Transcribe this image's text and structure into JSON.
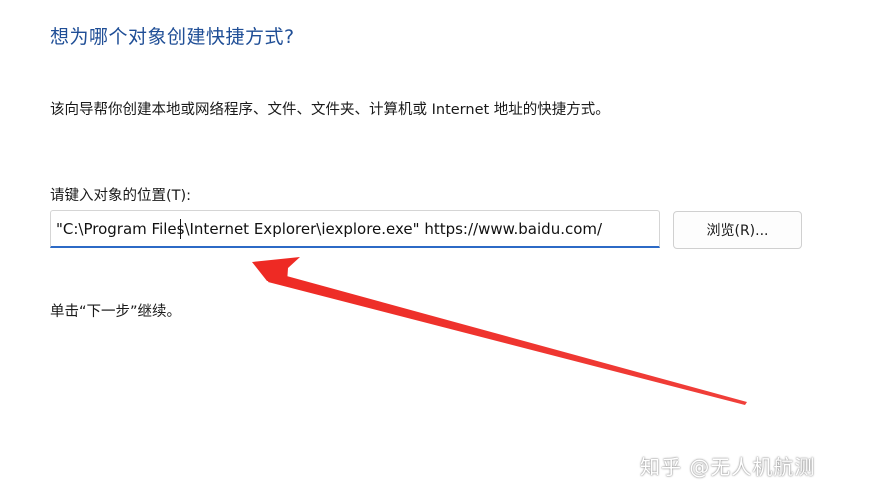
{
  "wizard": {
    "title": "想为哪个对象创建快捷方式?",
    "description": "该向导帮你创建本地或网络程序、文件、文件夹、计算机或 Internet 地址的快捷方式。",
    "location_label": "请键入对象的位置(T):",
    "location_value": "\"C:\\Program Files\\Internet Explorer\\iexplore.exe\" https://www.baidu.com/",
    "browse_label": "浏览(R)...",
    "next_hint": "单击“下一步”继续。"
  },
  "annotation": {
    "arrow_color": "#ee2a24",
    "accent_color": "#2c6ac6",
    "title_color": "#1f4e96"
  },
  "watermark": {
    "text": "知乎 @无人机航测"
  }
}
